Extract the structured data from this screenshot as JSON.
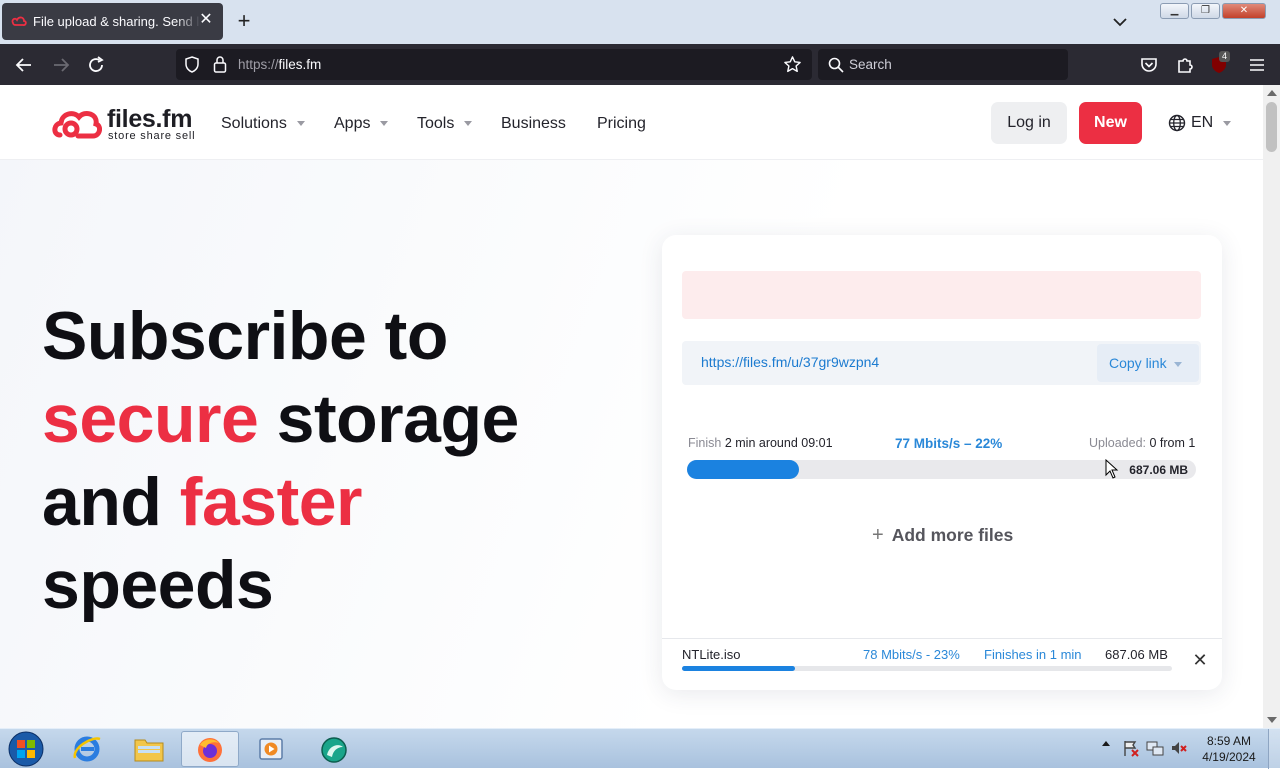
{
  "browser": {
    "tab_title": "File upload & sharing. Send large files",
    "url_scheme": "https://",
    "url_host": "files.fm",
    "search_placeholder": "Search",
    "extension_badge": "4"
  },
  "site": {
    "logo_text": "files.fm",
    "logo_tagline": "store  share  sell",
    "nav": {
      "solutions": "Solutions",
      "apps": "Apps",
      "tools": "Tools",
      "business": "Business",
      "pricing": "Pricing"
    },
    "login": "Log in",
    "new": "New",
    "language": "EN",
    "brand_color": "#ec2f43"
  },
  "hero": {
    "line1": "Subscribe to",
    "line2_red": "secure",
    "line2_rest": " storage",
    "line3_dark": "and ",
    "line3_red": "faster",
    "line4": "speeds"
  },
  "upload": {
    "share_link": "https://files.fm/u/37gr9wzpn4",
    "copy_link": "Copy link",
    "finish_label": "Finish",
    "finish_value": "2 min around 09:01",
    "speed": "77 Mbits/s – 22%",
    "uploaded_label": "Uploaded:",
    "uploaded_value": "0 from 1",
    "progress_percent": 22,
    "total_size": "687.06 MB",
    "add_more": "Add more files",
    "file": {
      "name": "NTLite.iso",
      "speed": "78 Mbits/s - 23%",
      "finishes": "Finishes in 1 min",
      "size": "687.06 MB",
      "progress_percent": 23
    }
  },
  "taskbar": {
    "time": "8:59 AM",
    "date": "4/19/2024"
  }
}
